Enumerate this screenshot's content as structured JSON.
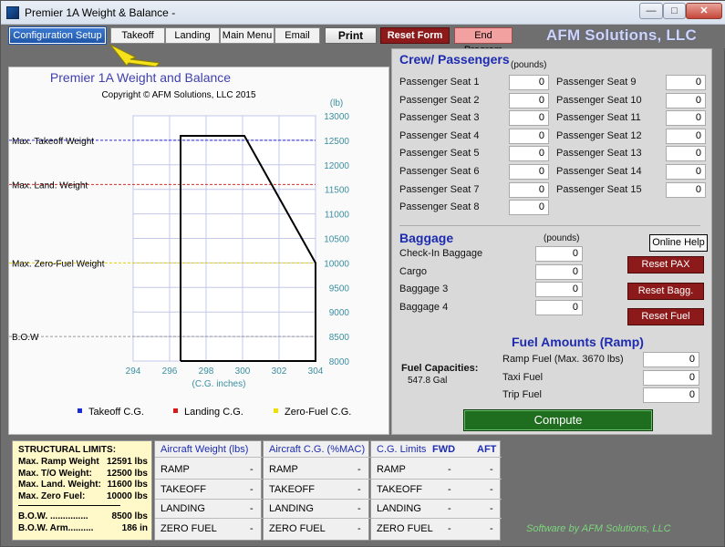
{
  "window": {
    "title": "Premier 1A Weight & Balance -"
  },
  "toolbar": {
    "configuration_setup": "Configuration Setup",
    "takeoff": "Takeoff",
    "landing": "Landing",
    "main_menu": "Main Menu",
    "email": "Email",
    "print": "Print",
    "reset_form": "Reset Form",
    "end_program": "End Program"
  },
  "brand": "AFM Solutions, LLC",
  "chart_data": {
    "type": "line",
    "title": "Premier 1A Weight and Balance",
    "subtitle": "Copyright © AFM Solutions, LLC 2015",
    "xlabel": "(C.G. inches)",
    "ylabel": "(lb)",
    "xlim": [
      294,
      304
    ],
    "ylim": [
      8000,
      13000
    ],
    "x_ticks": [
      "294",
      "296",
      "298",
      "300",
      "302",
      "304"
    ],
    "y_ticks": [
      "8000",
      "8500",
      "9000",
      "9500",
      "10000",
      "10500",
      "11000",
      "11500",
      "12000",
      "12500",
      "13000"
    ],
    "envelope": {
      "x": [
        296.6,
        296.6,
        300.1,
        304.0,
        304.0,
        296.6
      ],
      "y": [
        8000,
        12590,
        12590,
        10000,
        8000,
        8000
      ]
    },
    "reference_lines": [
      {
        "label": "Max. Takeoff Weight",
        "y": 12500,
        "color": "#2b2bd6"
      },
      {
        "label": "Max. Land. Weight",
        "y": 11600,
        "color": "#d62b2b"
      },
      {
        "label": "Max. Zero-Fuel Weight",
        "y": 10000,
        "color": "#e6cf00"
      },
      {
        "label": "B.O.W",
        "y": 8500,
        "color": "#999999"
      }
    ],
    "legend": [
      {
        "name": "Takeoff C.G.",
        "color": "#1a2bd6"
      },
      {
        "name": "Landing C.G.",
        "color": "#d61a1a"
      },
      {
        "name": "Zero-Fuel C.G.",
        "color": "#f0e000"
      }
    ],
    "grid": true
  },
  "crew": {
    "title": "Crew/ Passengers",
    "unit": "(pounds)",
    "left": [
      {
        "label": "Passenger Seat 1",
        "value": "0"
      },
      {
        "label": "Passenger Seat 2",
        "value": "0"
      },
      {
        "label": "Passenger Seat 3",
        "value": "0"
      },
      {
        "label": "Passenger Seat 4",
        "value": "0"
      },
      {
        "label": "Passenger Seat 5",
        "value": "0"
      },
      {
        "label": "Passenger Seat 6",
        "value": "0"
      },
      {
        "label": "Passenger Seat 7",
        "value": "0"
      },
      {
        "label": "Passenger Seat 8",
        "value": "0"
      }
    ],
    "right": [
      {
        "label": "Passenger Seat 9",
        "value": "0"
      },
      {
        "label": "Passenger Seat 10",
        "value": "0"
      },
      {
        "label": "Passenger Seat 11",
        "value": "0"
      },
      {
        "label": "Passenger Seat 12",
        "value": "0"
      },
      {
        "label": "Passenger Seat 13",
        "value": "0"
      },
      {
        "label": "Passenger Seat 14",
        "value": "0"
      },
      {
        "label": "Passenger Seat 15",
        "value": "0"
      }
    ]
  },
  "baggage": {
    "title": "Baggage",
    "unit": "(pounds)",
    "items": [
      {
        "label": "Check-In Baggage",
        "value": "0"
      },
      {
        "label": "Cargo",
        "value": "0"
      },
      {
        "label": "Baggage 3",
        "value": "0"
      },
      {
        "label": "Baggage 4",
        "value": "0"
      }
    ],
    "online_help": "Online Help",
    "reset_pax": "Reset PAX",
    "reset_bagg": "Reset Bagg.",
    "reset_fuel": "Reset Fuel"
  },
  "fuel": {
    "title": "Fuel Amounts (Ramp)",
    "capacities_label": "Fuel Capacities:",
    "capacity_value": "547.8 Gal",
    "items": [
      {
        "label": "Ramp Fuel (Max. 3670 lbs)",
        "value": "0"
      },
      {
        "label": "Taxi Fuel",
        "value": "0"
      },
      {
        "label": "Trip Fuel",
        "value": "0"
      }
    ],
    "compute": "Compute"
  },
  "limits": {
    "title": "STRUCTURAL LIMITS:",
    "rows": [
      {
        "label": "Max. Ramp Weight",
        "value": "12591 lbs"
      },
      {
        "label": "Max. T/O Weight:",
        "value": "12500 lbs"
      },
      {
        "label": "Max. Land. Weight:",
        "value": "11600 lbs"
      },
      {
        "label": "Max. Zero Fuel:",
        "value": "10000 lbs"
      }
    ],
    "bow_rows": [
      {
        "label": "B.O.W. ...............",
        "value": "8500 lbs"
      },
      {
        "label": "B.O.W. Arm..........",
        "value": "186 in"
      }
    ]
  },
  "aircraft_weight": {
    "title": "Aircraft Weight (lbs)",
    "rows": [
      {
        "label": "RAMP",
        "value": "-"
      },
      {
        "label": "TAKEOFF",
        "value": "-"
      },
      {
        "label": "LANDING",
        "value": "-"
      },
      {
        "label": "ZERO FUEL",
        "value": "-"
      }
    ]
  },
  "aircraft_cg": {
    "title": "Aircraft C.G. (%MAC)",
    "rows": [
      {
        "label": "RAMP",
        "value": "-"
      },
      {
        "label": "TAKEOFF",
        "value": "-"
      },
      {
        "label": "LANDING",
        "value": "-"
      },
      {
        "label": "ZERO FUEL",
        "value": "-"
      }
    ]
  },
  "cg_limits": {
    "title": "C.G. Limits",
    "fwd": "FWD",
    "aft": "AFT",
    "rows": [
      {
        "label": "RAMP",
        "fwd": "-",
        "aft": "-"
      },
      {
        "label": "TAKEOFF",
        "fwd": "-",
        "aft": "-"
      },
      {
        "label": "LANDING",
        "fwd": "-",
        "aft": "-"
      },
      {
        "label": "ZERO FUEL",
        "fwd": "-",
        "aft": "-"
      }
    ]
  },
  "signature": "Software by AFM Solutions, LLC"
}
